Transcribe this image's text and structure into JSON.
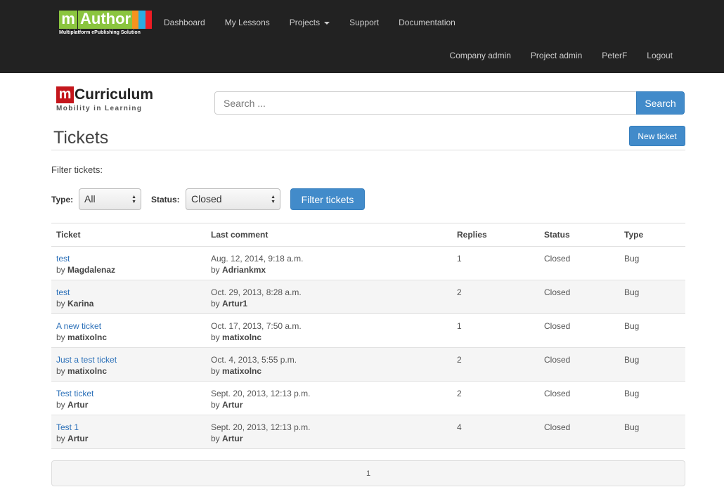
{
  "brand": {
    "mauthor_m": "m",
    "mauthor_word": "Author",
    "mauthor_tagline": "Multiplatform ePublishing Solution",
    "mcurriculum_m": "m",
    "mcurriculum_word": "Curriculum",
    "mcurriculum_tagline": "Mobility in Learning"
  },
  "nav_top": [
    "Dashboard",
    "My Lessons",
    "Projects",
    "Support",
    "Documentation"
  ],
  "nav_bottom": [
    "Company admin",
    "Project admin",
    "PeterF",
    "Logout"
  ],
  "search": {
    "placeholder": "Search ...",
    "button": "Search"
  },
  "page": {
    "title": "Tickets",
    "new_ticket": "New ticket"
  },
  "filters": {
    "heading": "Filter tickets:",
    "type_label": "Type:",
    "type_value": "All",
    "status_label": "Status:",
    "status_value": "Closed",
    "button": "Filter tickets"
  },
  "table": {
    "headers": [
      "Ticket",
      "Last comment",
      "Replies",
      "Status",
      "Type"
    ],
    "rows": [
      {
        "title": "test",
        "author": "Magdalenaz",
        "date": "Aug. 12, 2014, 9:18 a.m.",
        "commenter": "Adriankmx",
        "replies": "1",
        "status": "Closed",
        "type": "Bug"
      },
      {
        "title": "test",
        "author": "Karina",
        "date": "Oct. 29, 2013, 8:28 a.m.",
        "commenter": "Artur1",
        "replies": "2",
        "status": "Closed",
        "type": "Bug"
      },
      {
        "title": "A new ticket",
        "author": "matixolnc",
        "date": "Oct. 17, 2013, 7:50 a.m.",
        "commenter": "matixolnc",
        "replies": "1",
        "status": "Closed",
        "type": "Bug"
      },
      {
        "title": "Just a test ticket",
        "author": "matixolnc",
        "date": "Oct. 4, 2013, 5:55 p.m.",
        "commenter": "matixolnc",
        "replies": "2",
        "status": "Closed",
        "type": "Bug"
      },
      {
        "title": "Test ticket",
        "author": "Artur",
        "date": "Sept. 20, 2013, 12:13 p.m.",
        "commenter": "Artur",
        "replies": "2",
        "status": "Closed",
        "type": "Bug"
      },
      {
        "title": "Test 1",
        "author": "Artur",
        "date": "Sept. 20, 2013, 12:13 p.m.",
        "commenter": "Artur",
        "replies": "4",
        "status": "Closed",
        "type": "Bug"
      }
    ],
    "by_prefix": "by"
  },
  "pagination": {
    "current_page": "1"
  },
  "colors": {
    "navbar": "#222222",
    "primary": "#428bca",
    "link": "#2a6fb8",
    "mauthor_green": "#8bc53f",
    "mcurriculum_red": "#c4161c"
  }
}
